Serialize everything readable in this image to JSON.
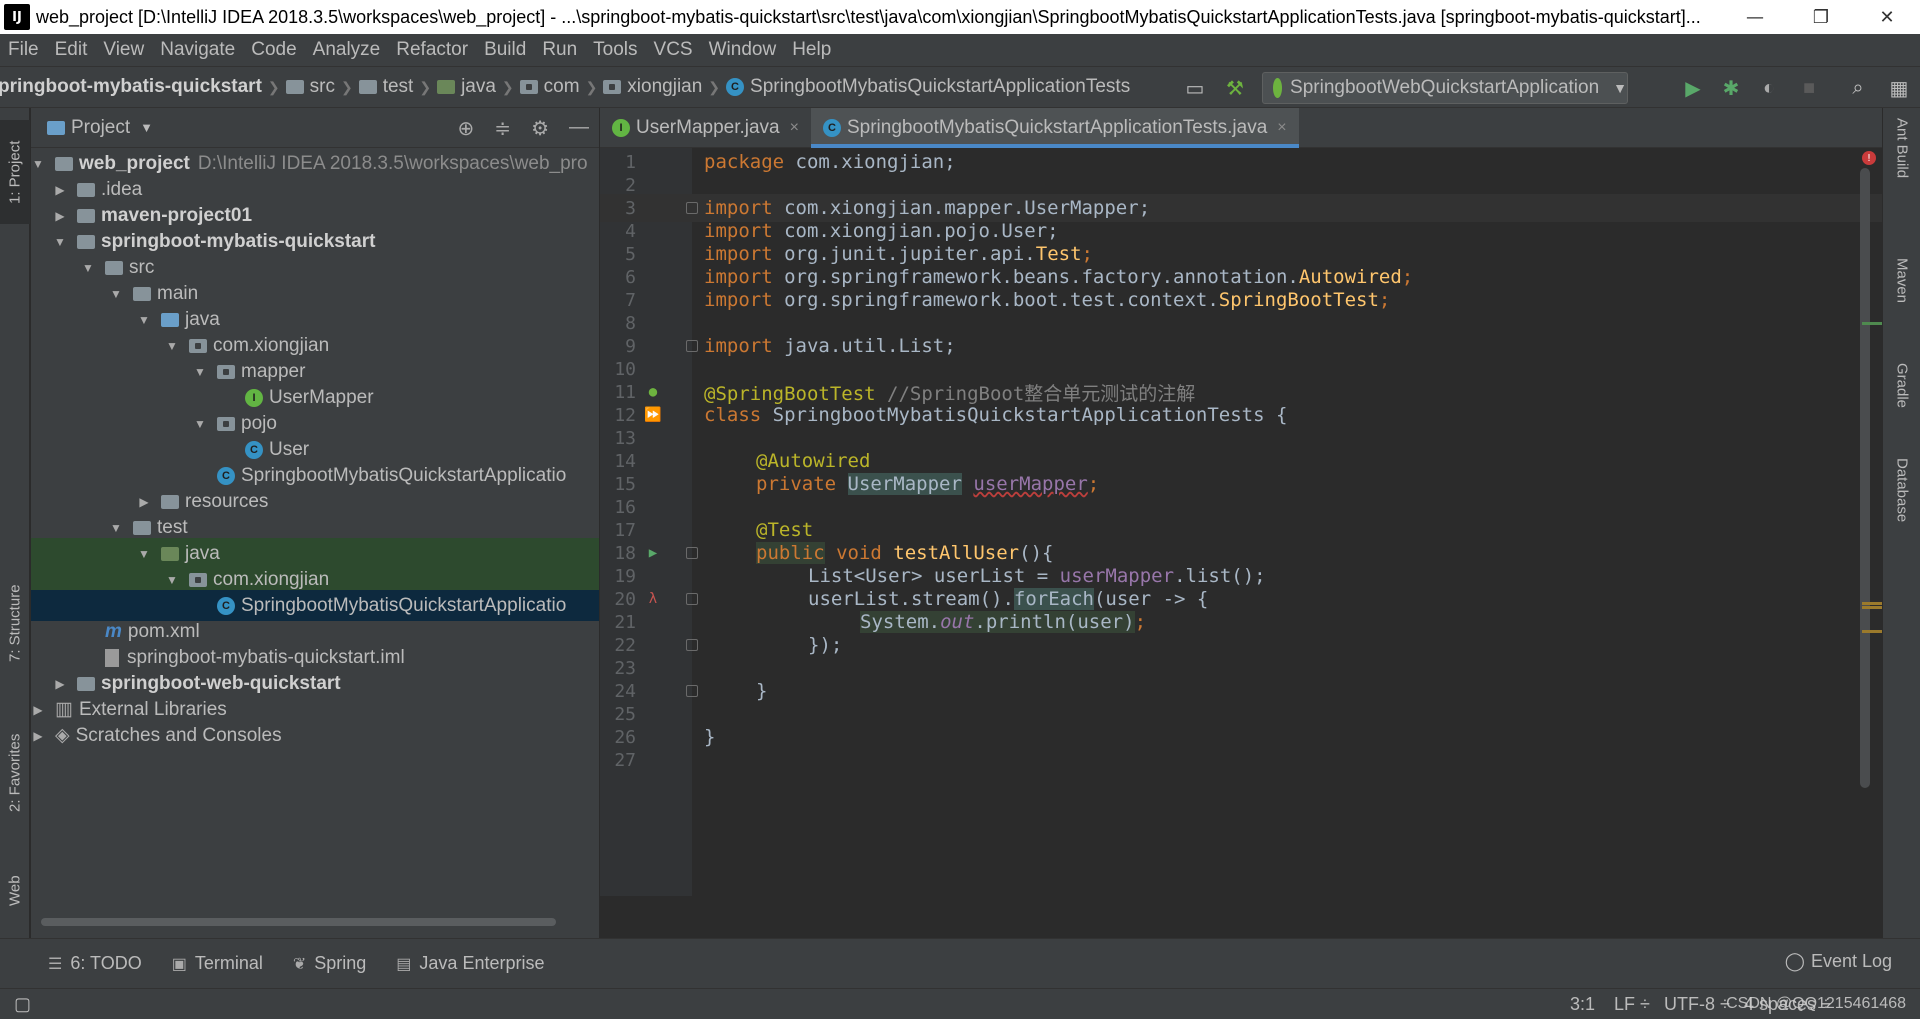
{
  "window": {
    "logo": "IJ",
    "title": "web_project [D:\\IntelliJ IDEA 2018.3.5\\workspaces\\web_project] - ...\\springboot-mybatis-quickstart\\src\\test\\java\\com\\xiongjian\\SpringbootMybatisQuickstartApplicationTests.java [springboot-mybatis-quickstart]...",
    "minimize": "—",
    "maximize": "❐",
    "close": "✕"
  },
  "menu": [
    "File",
    "Edit",
    "View",
    "Navigate",
    "Code",
    "Analyze",
    "Refactor",
    "Build",
    "Run",
    "Tools",
    "VCS",
    "Window",
    "Help"
  ],
  "breadcrumb": [
    "pringboot-mybatis-quickstart",
    "src",
    "test",
    "java",
    "com",
    "xiongjian",
    "SpringbootMybatisQuickstartApplicationTests"
  ],
  "run_config": "SpringbootWebQuickstartApplication",
  "left_tabs": {
    "project": "1: Project",
    "structure": "7: Structure",
    "favorites": "2: Favorites",
    "web": "Web"
  },
  "right_tabs": [
    "Ant Build",
    "Maven",
    "Gradle",
    "Database"
  ],
  "project_panel": {
    "title": "Project",
    "tree": [
      {
        "label": "web_project",
        "path": "D:\\IntelliJ IDEA 2018.3.5\\workspaces\\web_pro",
        "bold": true
      },
      {
        "label": ".idea"
      },
      {
        "label": "maven-project01",
        "bold": true
      },
      {
        "label": "springboot-mybatis-quickstart",
        "bold": true
      },
      {
        "label": "src"
      },
      {
        "label": "main"
      },
      {
        "label": "java"
      },
      {
        "label": "com.xiongjian"
      },
      {
        "label": "mapper"
      },
      {
        "label": "UserMapper"
      },
      {
        "label": "pojo"
      },
      {
        "label": "User"
      },
      {
        "label": "SpringbootMybatisQuickstartApplicatio"
      },
      {
        "label": "resources"
      },
      {
        "label": "test"
      },
      {
        "label": "java"
      },
      {
        "label": "com.xiongjian"
      },
      {
        "label": "SpringbootMybatisQuickstartApplicatio"
      },
      {
        "label": "pom.xml"
      },
      {
        "label": "springboot-mybatis-quickstart.iml"
      },
      {
        "label": "springboot-web-quickstart",
        "bold": true
      },
      {
        "label": "External Libraries"
      },
      {
        "label": "Scratches and Consoles"
      }
    ]
  },
  "editor": {
    "tabs": [
      {
        "label": "UserMapper.java",
        "active": false
      },
      {
        "label": "SpringbootMybatisQuickstartApplicationTests.java",
        "active": true
      }
    ],
    "line_numbers": [
      "1",
      "2",
      "3",
      "4",
      "5",
      "6",
      "7",
      "8",
      "9",
      "10",
      "11",
      "12",
      "13",
      "14",
      "15",
      "16",
      "17",
      "18",
      "19",
      "20",
      "21",
      "22",
      "23",
      "24",
      "25",
      "26",
      "27"
    ],
    "code": {
      "l1": [
        "package",
        " com.xiongjian;"
      ],
      "l3": [
        "import",
        " com.xiongjian.mapper.UserMapper;"
      ],
      "l4": [
        "import",
        " com.xiongjian.pojo.User;"
      ],
      "l5": [
        "import",
        " org.junit.jupiter.api.",
        "Test",
        ";"
      ],
      "l6": [
        "import",
        " org.springframework.beans.factory.annotation.",
        "Autowired",
        ";"
      ],
      "l7": [
        "import",
        " org.springframework.boot.test.context.",
        "SpringBootTest",
        ";"
      ],
      "l9": [
        "import",
        " java.util.List;"
      ],
      "l11": [
        "@SpringBootTest",
        " //SpringBoot整合单元测试的注解"
      ],
      "l12": [
        "class",
        " SpringbootMybatisQuickstartApplicationTests {"
      ],
      "l14": [
        "@Autowired"
      ],
      "l15": [
        "private",
        " ",
        "UserMapper",
        " ",
        "userMapper",
        ";"
      ],
      "l17": [
        "@Test"
      ],
      "l18": [
        "public",
        " void ",
        "testAllUser",
        "(){"
      ],
      "l19": [
        "List<User> userList = ",
        "userMapper",
        ".list();"
      ],
      "l20": [
        "userList.stream().",
        "forEach",
        "(user -> {"
      ],
      "l21": [
        "System.",
        "out",
        ".println(user)",
        ";"
      ],
      "l22": [
        "});"
      ],
      "l24": [
        "}"
      ],
      "l26": [
        "}"
      ]
    }
  },
  "bottom_tools": [
    {
      "label": "6: TODO",
      "icon": "list-icon"
    },
    {
      "label": "Terminal",
      "icon": "terminal-icon"
    },
    {
      "label": "Spring",
      "icon": "spring-icon"
    },
    {
      "label": "Java Enterprise",
      "icon": "java-enterprise-icon"
    }
  ],
  "event_log": "Event Log",
  "status": {
    "position": "3:1",
    "line_sep": "LF ÷",
    "encoding": "UTF-8 ÷",
    "indent": "4 spaces ÷"
  },
  "watermark": "CSDN @QQ1215461468",
  "colors": {
    "keyword": "#cc7832",
    "annotation": "#bbb529",
    "field": "#9876aa",
    "method": "#ffc66d",
    "text": "#a9b7c6",
    "comment": "#808080",
    "editor_bg": "#2b2b2b",
    "panel_bg": "#3c3f41",
    "tab_accent": "#4a88c7"
  }
}
